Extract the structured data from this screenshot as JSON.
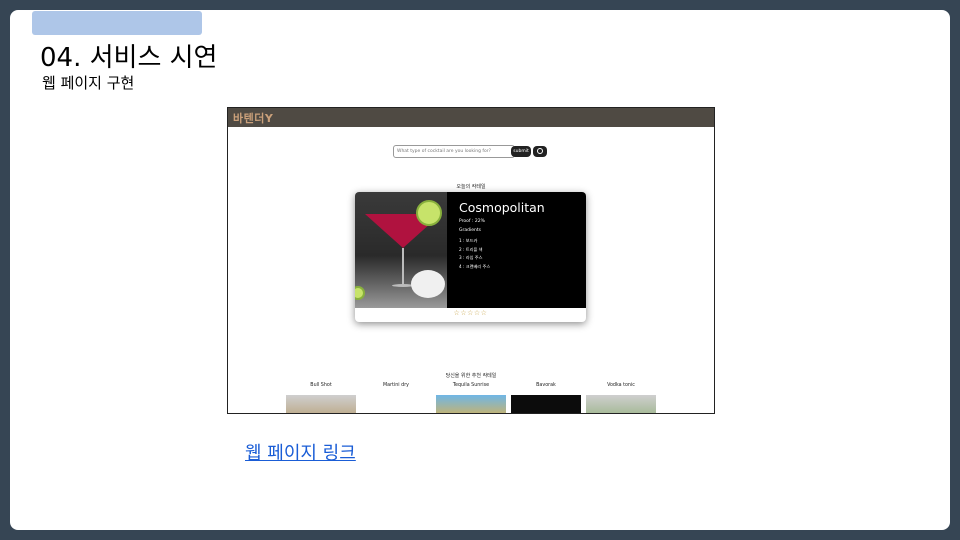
{
  "slide": {
    "title": "04. 서비스 시연",
    "subtitle": "웹 페이지 구현",
    "link_text": "웹 페이지 링크"
  },
  "webapp": {
    "logo": "바텐더Y",
    "search": {
      "placeholder": "What type of cocktail are you looking for?"
    },
    "submit_label": "submit",
    "today_label": "오늘의 칵테일",
    "featured": {
      "name": "Cosmopolitan",
      "proof": "Proof : 22%",
      "gradients_label": "Gradients",
      "ingredients": [
        "1 : 보드카",
        "2 : 트리플 섹",
        "3 : 라임 주스",
        "4 : 크랜베리 주스"
      ],
      "rating_stars": "☆☆☆☆☆"
    },
    "recommend_label": "당신을 위한 추천 칵테일",
    "recommendations": [
      {
        "name": "Bull Shot"
      },
      {
        "name": "Martini dry"
      },
      {
        "name": "Tequila Sunrise"
      },
      {
        "name": "Bavorak"
      },
      {
        "name": "Vodka tonic"
      }
    ]
  },
  "colors": {
    "frame": "#364554",
    "accent_bar": "#aec6e8",
    "navbar": "#4f4a43",
    "link": "#1a5dd6",
    "star": "#c9a64a"
  }
}
